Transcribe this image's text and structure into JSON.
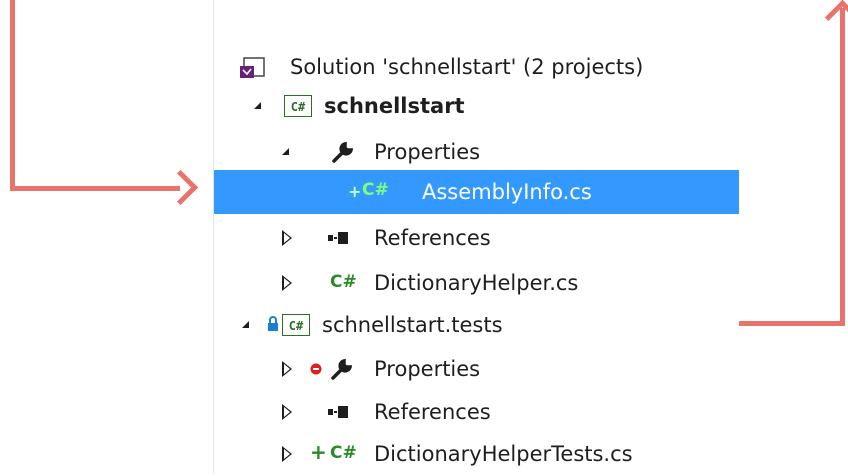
{
  "solution_explorer": {
    "solution_label": "Solution 'schnellstart' (2 projects)",
    "project1": {
      "name": "schnellstart",
      "properties_label": "Properties",
      "assemblyinfo_label": "AssemblyInfo.cs",
      "references_label": "References",
      "dictionaryhelper_label": "DictionaryHelper.cs"
    },
    "project2": {
      "name": "schnellstart.tests",
      "properties_label": "Properties",
      "references_label": "References",
      "dictionaryhelpertests_label": "DictionaryHelperTests.cs"
    },
    "cs_badge": "C#"
  },
  "colors": {
    "selection": "#3399ff",
    "arrow": "#e8736c",
    "csharp_green": "#2a8a2a"
  },
  "icons": [
    "visual-studio-solution-icon",
    "csharp-project-icon",
    "wrench-icon",
    "csharp-file-icon",
    "references-icon",
    "lock-icon",
    "plus-icon",
    "minus-icon"
  ]
}
